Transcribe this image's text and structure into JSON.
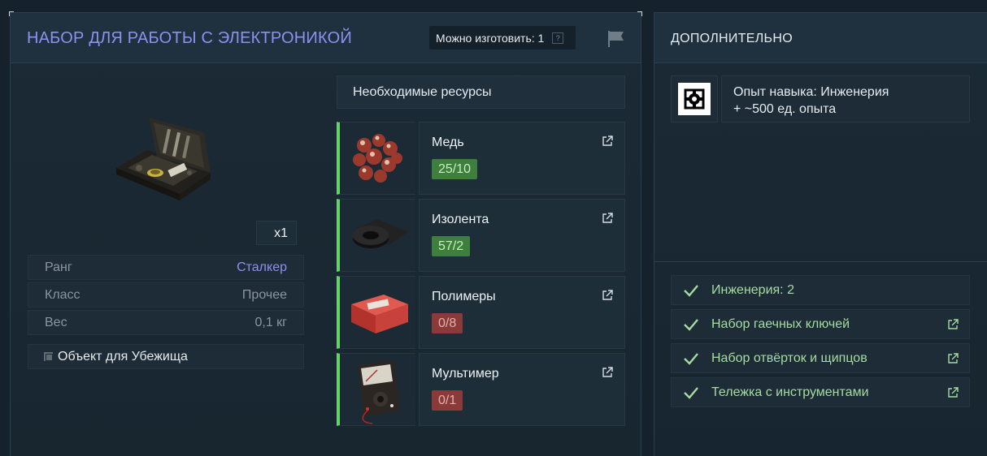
{
  "item": {
    "title": "НАБОР ДЛЯ РАБОТЫ С ЭЛЕКТРОНИКОЙ",
    "craft_available": "Можно изготовить: 1",
    "help_glyph": "?",
    "quantity": "x1",
    "stats": [
      {
        "label": "Ранг",
        "value": "Сталкер"
      },
      {
        "label": "Класс",
        "value": "Прочее"
      },
      {
        "label": "Вес",
        "value": "0,1 кг"
      }
    ],
    "shelter_label": "Объект для Убежища"
  },
  "resources": {
    "header": "Необходимые ресурсы",
    "items": [
      {
        "name": "Медь",
        "count": "25/10",
        "status": "ok"
      },
      {
        "name": "Изолента",
        "count": "57/2",
        "status": "ok"
      },
      {
        "name": "Полимеры",
        "count": "0/8",
        "status": "bad"
      },
      {
        "name": "Мультимер",
        "count": "0/1",
        "status": "bad"
      }
    ]
  },
  "extra": {
    "title": "ДОПОЛНИТЕЛЬНО",
    "skill_line1": "Опыт навыка: Инженерия",
    "skill_line2": "+ ~500 ед. опыта",
    "requirements": [
      "Инженерия: 2",
      "Набор гаечных ключей",
      "Набор отвёрток и щипцов",
      "Тележка с инструментами"
    ]
  },
  "colors": {
    "accent": "#8f8ff0",
    "ok": "#3f7f3d",
    "bad": "#8a3a38",
    "resource_bar": "#64d36a",
    "check": "#a6dca0"
  }
}
